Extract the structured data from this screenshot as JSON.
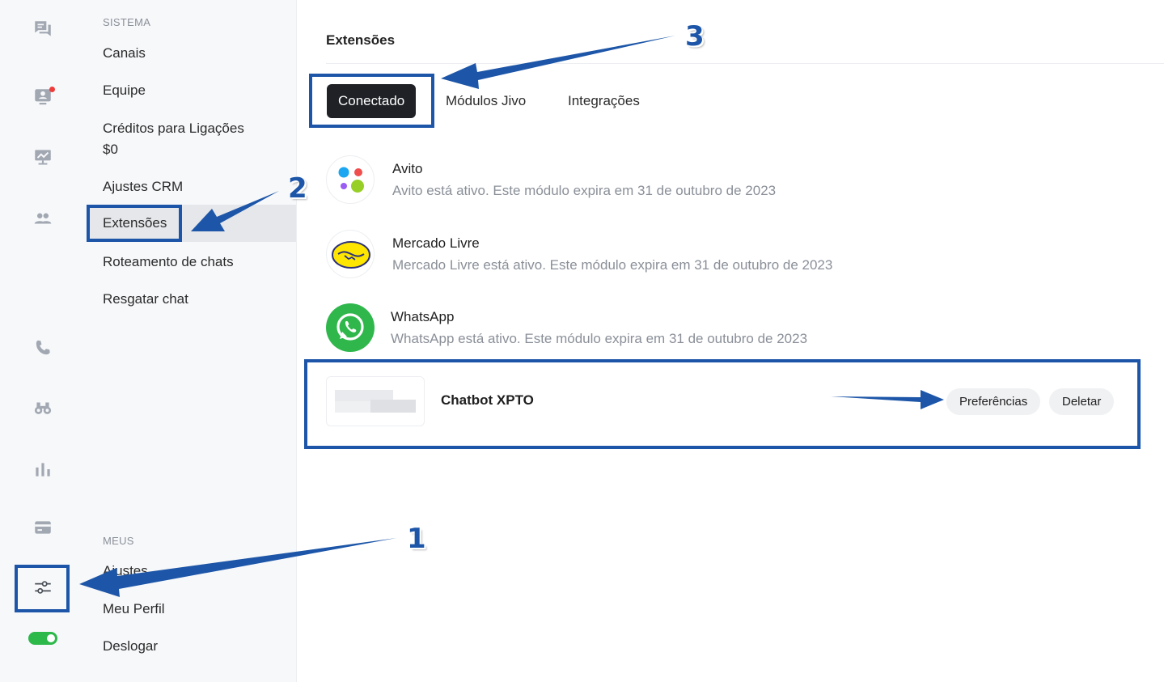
{
  "rail": {
    "icons": [
      "chat-bubbles-icon",
      "operator-icon",
      "presentation-chart-icon",
      "team-icon",
      "phone-icon",
      "binoculars-icon",
      "bar-chart-icon",
      "card-icon",
      "settings-sliders-icon"
    ],
    "status_toggle_on": true,
    "accent_color": "#2db84a",
    "notification_color": "#ee3c3c"
  },
  "menu": {
    "section_system": "SISTEMA",
    "items": [
      {
        "label": "Canais"
      },
      {
        "label": "Equipe"
      },
      {
        "label": "Créditos para Ligações",
        "sub": "$0"
      },
      {
        "label": "Ajustes CRM"
      },
      {
        "label": "Extensões",
        "active": true
      },
      {
        "label": "Roteamento de chats"
      },
      {
        "label": "Resgatar chat"
      }
    ],
    "section_mine": "MEUS",
    "mine_items": [
      {
        "label": "Ajustes"
      },
      {
        "label": "Meu Perfil"
      },
      {
        "label": "Deslogar"
      }
    ]
  },
  "main": {
    "title": "Extensões",
    "tabs": [
      {
        "label": "Conectado",
        "active": true
      },
      {
        "label": "Módulos Jivo"
      },
      {
        "label": "Integrações"
      }
    ],
    "extensions": [
      {
        "name": "Avito",
        "description": "Avito está ativo. Este módulo expira em 31 de outubro de 2023",
        "icon": "avito-logo-icon"
      },
      {
        "name": "Mercado Livre",
        "description": "Mercado Livre está ativo. Este módulo expira em 31 de outubro de 2023",
        "icon": "mercado-livre-logo-icon"
      },
      {
        "name": "WhatsApp",
        "description": "WhatsApp está ativo. Este módulo expira em 31 de outubro de 2023",
        "icon": "whatsapp-logo-icon"
      }
    ],
    "chatbot": {
      "name": "Chatbot XPTO",
      "preferences_label": "Preferências",
      "delete_label": "Deletar"
    }
  },
  "annotations": {
    "markers": [
      "1",
      "2",
      "3"
    ],
    "color": "#1d56a8"
  }
}
